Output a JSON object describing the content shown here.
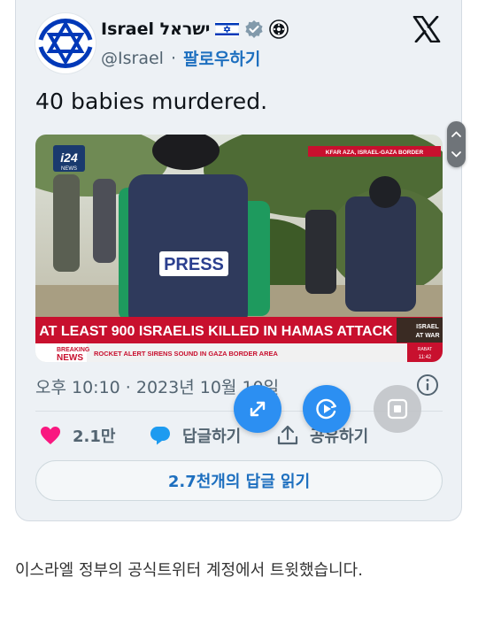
{
  "tweet": {
    "author_name": "Israel ישראל",
    "handle": "@Israel",
    "separator": "·",
    "follow_label": "팔로우하기",
    "text": "40 babies murdered.",
    "timestamp": "오후 10:10 · 2023년 10월 10일"
  },
  "media": {
    "logo_text": "i24",
    "logo_sub": "NEWS",
    "location_tag": "KFAR AZA, ISRAEL-GAZA BORDER",
    "vest_label": "PRESS",
    "headline": "AT LEAST 900 ISRAELIS KILLED IN HAMAS ATTACK",
    "breaking_1": "BREAKING",
    "breaking_2": "NEWS",
    "ticker": "ROCKET ALERT SIRENS SOUND IN GAZA BORDER AREA",
    "badge_1": "ISRAEL",
    "badge_2": "AT WAR",
    "clock_label": "RABAT",
    "clock_time": "11:42"
  },
  "actions": {
    "like_count": "2.1만",
    "reply_label": "답글하기",
    "share_label": "공유하기",
    "read_replies_label": "2.7천개의 답글 읽기"
  },
  "caption": "이스라엘 정부의 공식트위터 계정에서 트윗했습니다.",
  "colors": {
    "card_bg": "#edf1f5",
    "link_blue": "#1d6fbf",
    "like_pink": "#f91880",
    "reply_blue": "#1d9bf0",
    "fab_blue": "#2c8ff2",
    "headline_red": "#c8102e",
    "israel_blue": "#0038b8"
  },
  "icons": [
    "israel-flag-icon",
    "verified-badge-icon",
    "gov-org-icon",
    "x-logo-icon",
    "info-icon",
    "heart-icon",
    "reply-bubble-icon",
    "share-icon",
    "expand-icon",
    "screen-capture-icon",
    "stop-icon"
  ]
}
